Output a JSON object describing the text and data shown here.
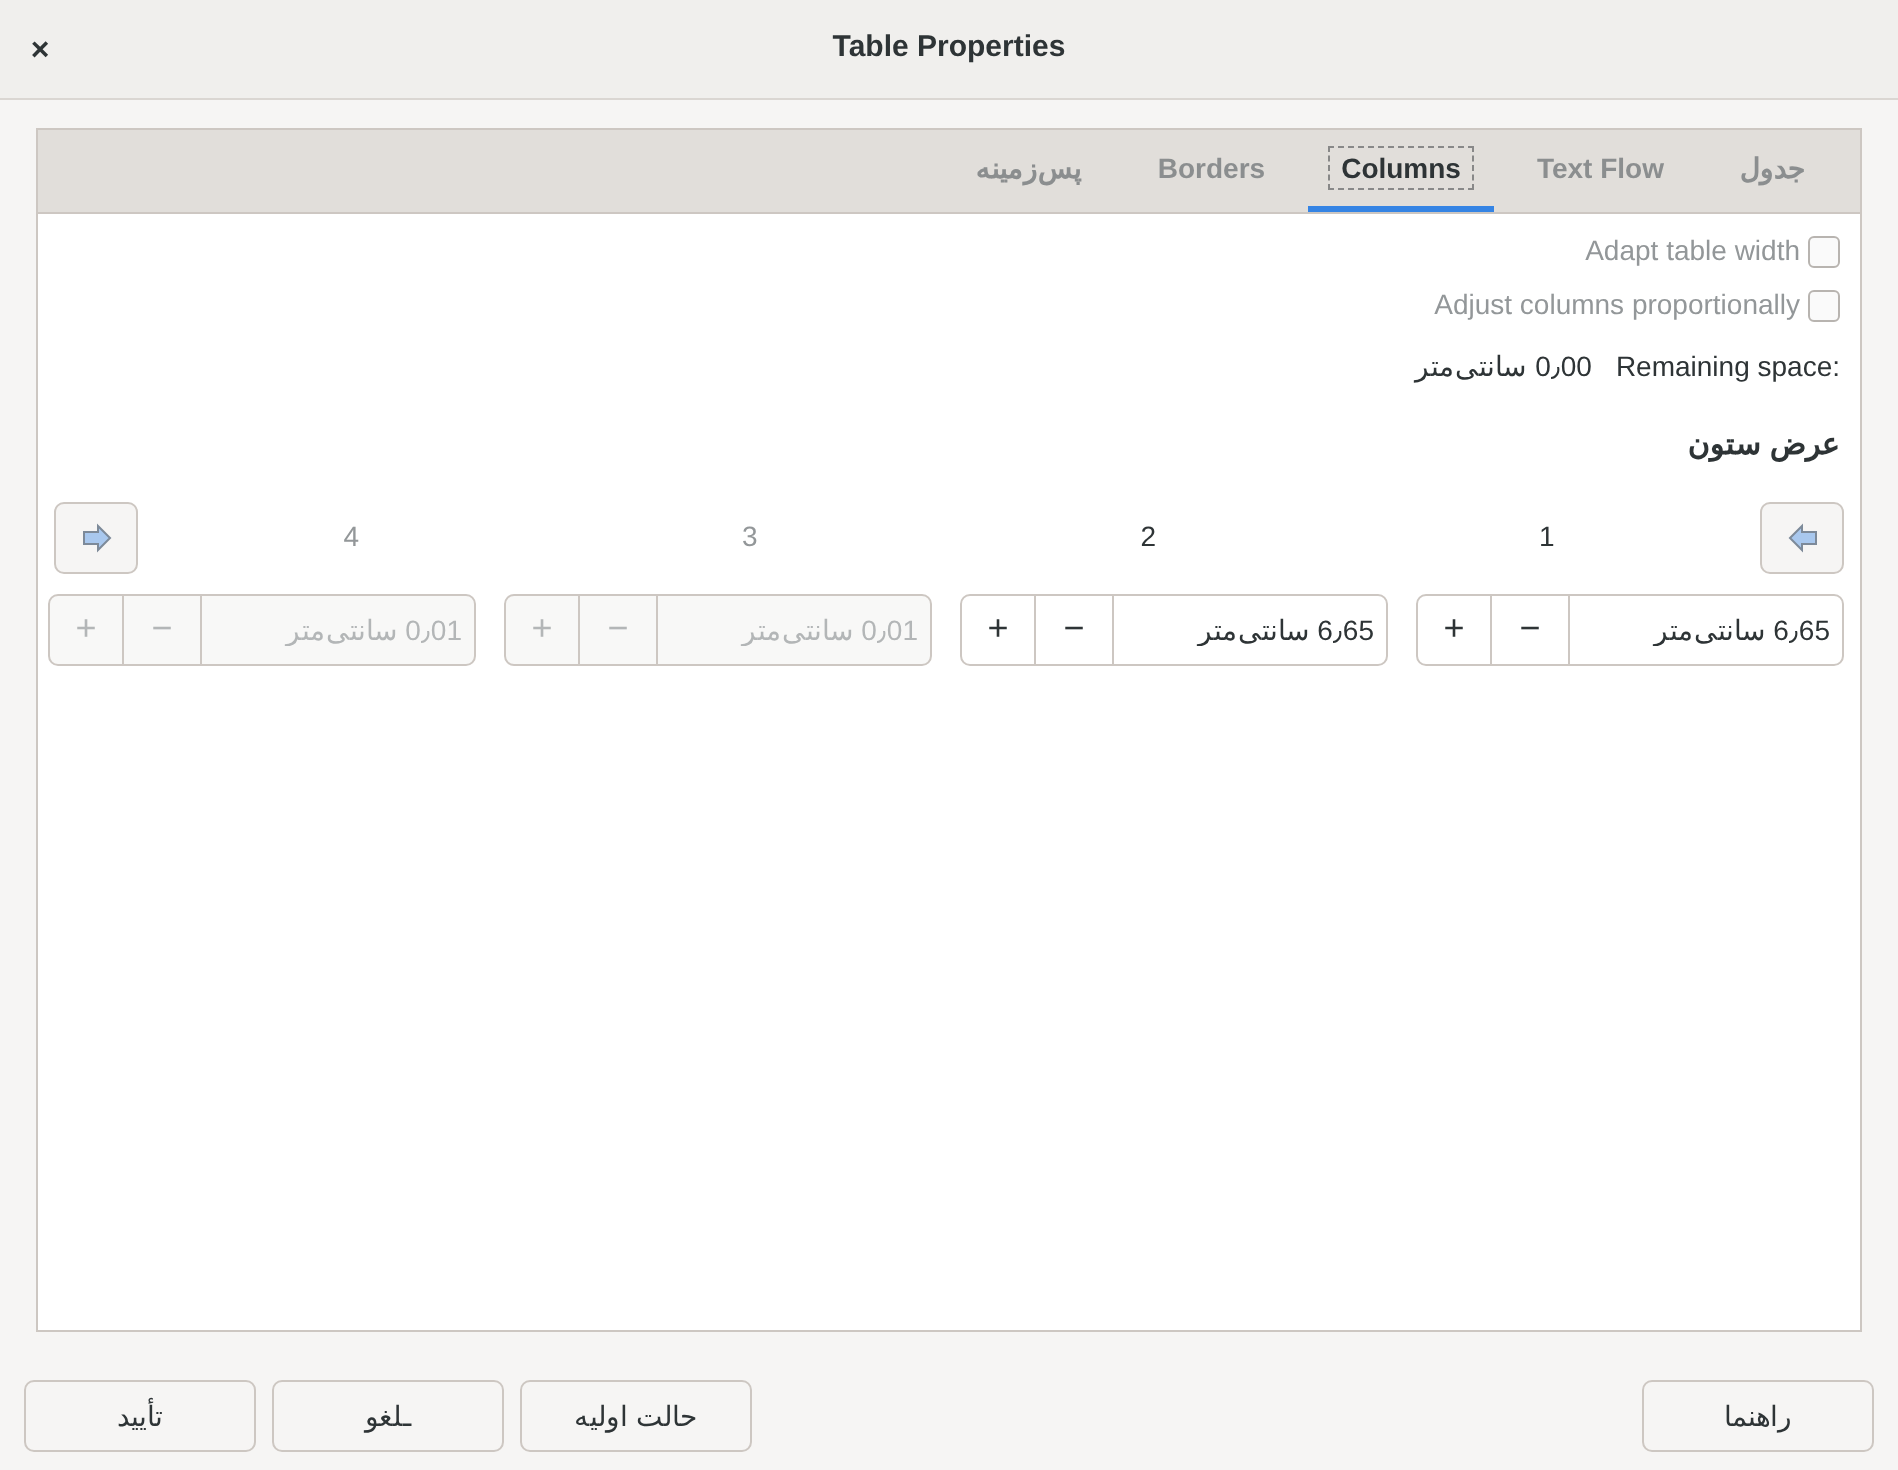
{
  "window": {
    "title": "Table Properties",
    "close": "×"
  },
  "tabs": [
    {
      "label": "جدول",
      "selected": false
    },
    {
      "label": "Text Flow",
      "selected": false
    },
    {
      "label": "Columns",
      "selected": true
    },
    {
      "label": "Borders",
      "selected": false
    },
    {
      "label": "پس‌زمینه",
      "selected": false
    }
  ],
  "options": [
    {
      "label": "Adapt table width",
      "checked": false,
      "disabled": true
    },
    {
      "label": "Adjust columns proportionally",
      "checked": false,
      "disabled": true
    }
  ],
  "remaining": {
    "label": "Remaining space:",
    "value": "0٫00 سانتی‌متر"
  },
  "section_title": "عرض ستون",
  "columns": [
    {
      "label": "1",
      "value": "6٫65 سانتی‌متر",
      "disabled": false,
      "plus": "+",
      "minus": "−"
    },
    {
      "label": "2",
      "value": "6٫65 سانتی‌متر",
      "disabled": false,
      "plus": "+",
      "minus": "−"
    },
    {
      "label": "3",
      "value": "0٫01 سانتی‌متر",
      "disabled": true,
      "plus": "+",
      "minus": "−"
    },
    {
      "label": "4",
      "value": "0٫01 سانتی‌متر",
      "disabled": true,
      "plus": "+",
      "minus": "−"
    }
  ],
  "buttons": [
    {
      "label": "راهنما"
    },
    {
      "label": "حالت اولیه"
    },
    {
      "label": "ـلغو"
    },
    {
      "label": "تأیید"
    }
  ]
}
